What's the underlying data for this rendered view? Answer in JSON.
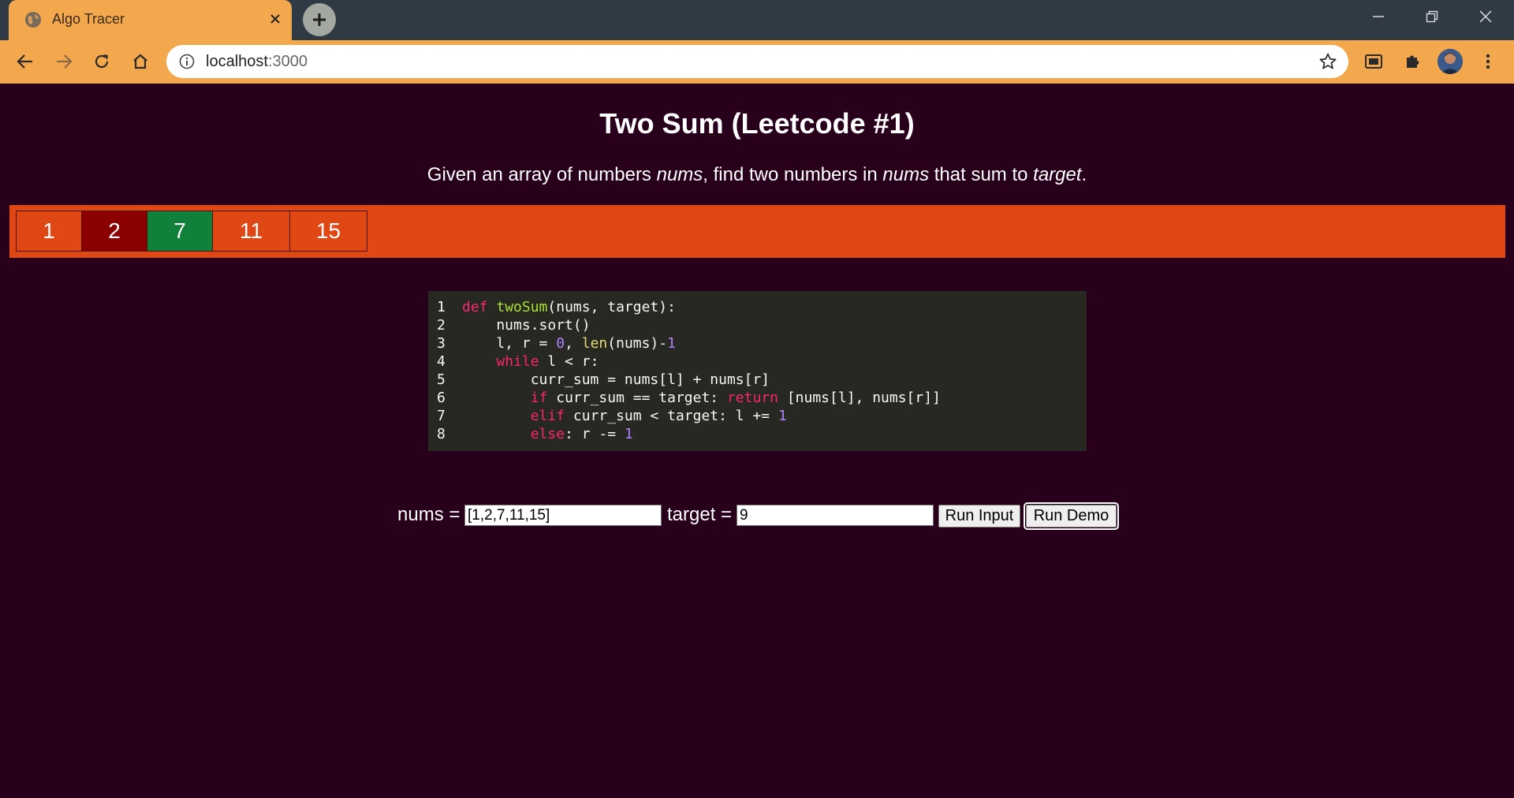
{
  "browser": {
    "tab_title": "Algo Tracer",
    "url_host": "localhost",
    "url_port": ":3000"
  },
  "page": {
    "title": "Two Sum (Leetcode #1)",
    "desc_1": "Given an array of numbers ",
    "desc_2": "nums",
    "desc_3": ", find two numbers in ",
    "desc_4": "nums",
    "desc_5": " that sum to ",
    "desc_6": "target",
    "desc_7": "."
  },
  "array": {
    "cells": [
      {
        "value": "1",
        "state": "default",
        "color": "#df4715"
      },
      {
        "value": "2",
        "state": "left-pointer",
        "color": "#8b0000"
      },
      {
        "value": "7",
        "state": "right-pointer",
        "color": "#10803a"
      },
      {
        "value": "11",
        "state": "default",
        "color": "#df4715"
      },
      {
        "value": "15",
        "state": "default",
        "color": "#df4715"
      }
    ]
  },
  "code": {
    "line_numbers": [
      "1",
      "2",
      "3",
      "4",
      "5",
      "6",
      "7",
      "8"
    ],
    "l1": {
      "kw": "def",
      "fn": "twoSum",
      "rest": "(nums, target):"
    },
    "l2": {
      "text": "    nums.sort()"
    },
    "l3": {
      "a": "    l, r = ",
      "n0": "0",
      "b": ", ",
      "bi": "len",
      "c": "(nums)-",
      "n1": "1"
    },
    "l4": {
      "ind": "    ",
      "kw": "while",
      "rest": " l < r:"
    },
    "l5": {
      "text": "        curr_sum = nums[l] + nums[r]"
    },
    "l6": {
      "ind": "        ",
      "kw1": "if",
      "mid": " curr_sum == target: ",
      "kw2": "return",
      "rest": " [nums[l], nums[r]]"
    },
    "l7": {
      "ind": "        ",
      "kw": "elif",
      "mid": " curr_sum < target: l += ",
      "n": "1"
    },
    "l8": {
      "ind": "        ",
      "kw": "else",
      "mid": ": r -= ",
      "n": "1"
    }
  },
  "controls": {
    "nums_label": "nums =",
    "nums_value": "[1,2,7,11,15]",
    "target_label": "target =",
    "target_value": "9",
    "run_input_label": "Run Input",
    "run_demo_label": "Run Demo"
  }
}
